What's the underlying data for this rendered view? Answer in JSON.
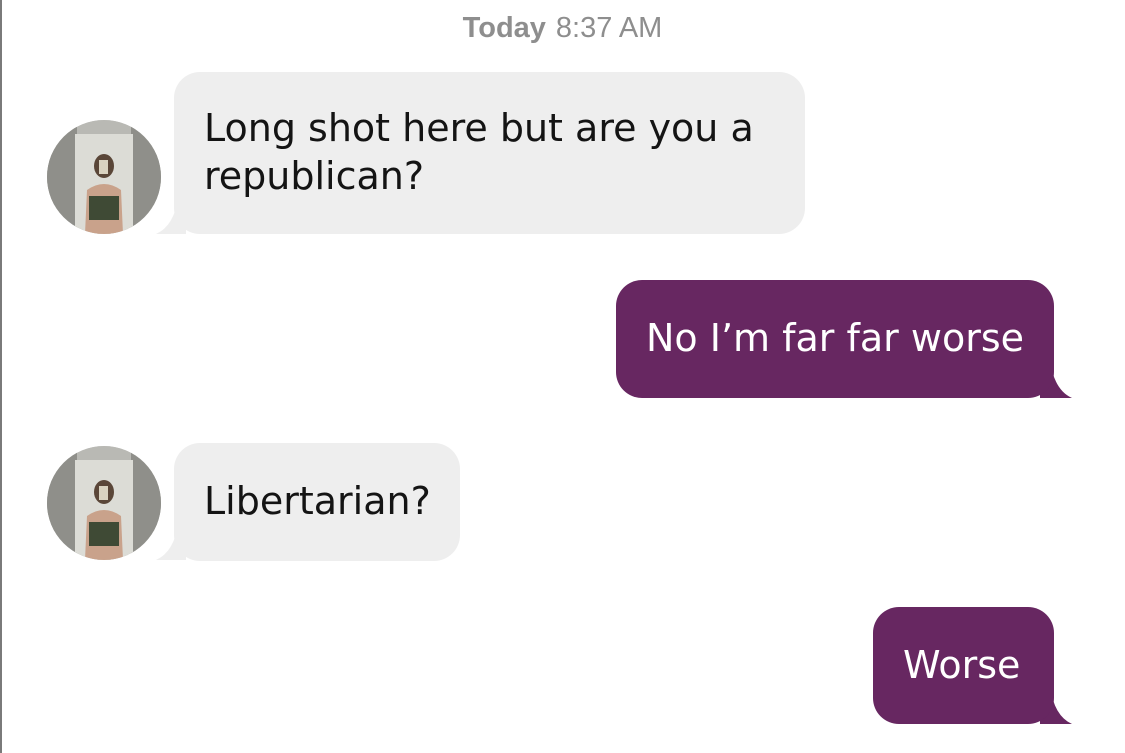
{
  "header": {
    "day": "Today",
    "time": "8:37 AM"
  },
  "colors": {
    "incoming_bubble": "#eeeeee",
    "outgoing_bubble": "#672761",
    "timestamp": "#8e8e8e"
  },
  "messages": [
    {
      "direction": "incoming",
      "text": "Long shot here but are you a republican?",
      "avatar": "contact-avatar-photo"
    },
    {
      "direction": "outgoing",
      "text": "No I’m far far worse"
    },
    {
      "direction": "incoming",
      "text": "Libertarian?",
      "avatar": "contact-avatar-photo"
    },
    {
      "direction": "outgoing",
      "text": "Worse"
    }
  ]
}
